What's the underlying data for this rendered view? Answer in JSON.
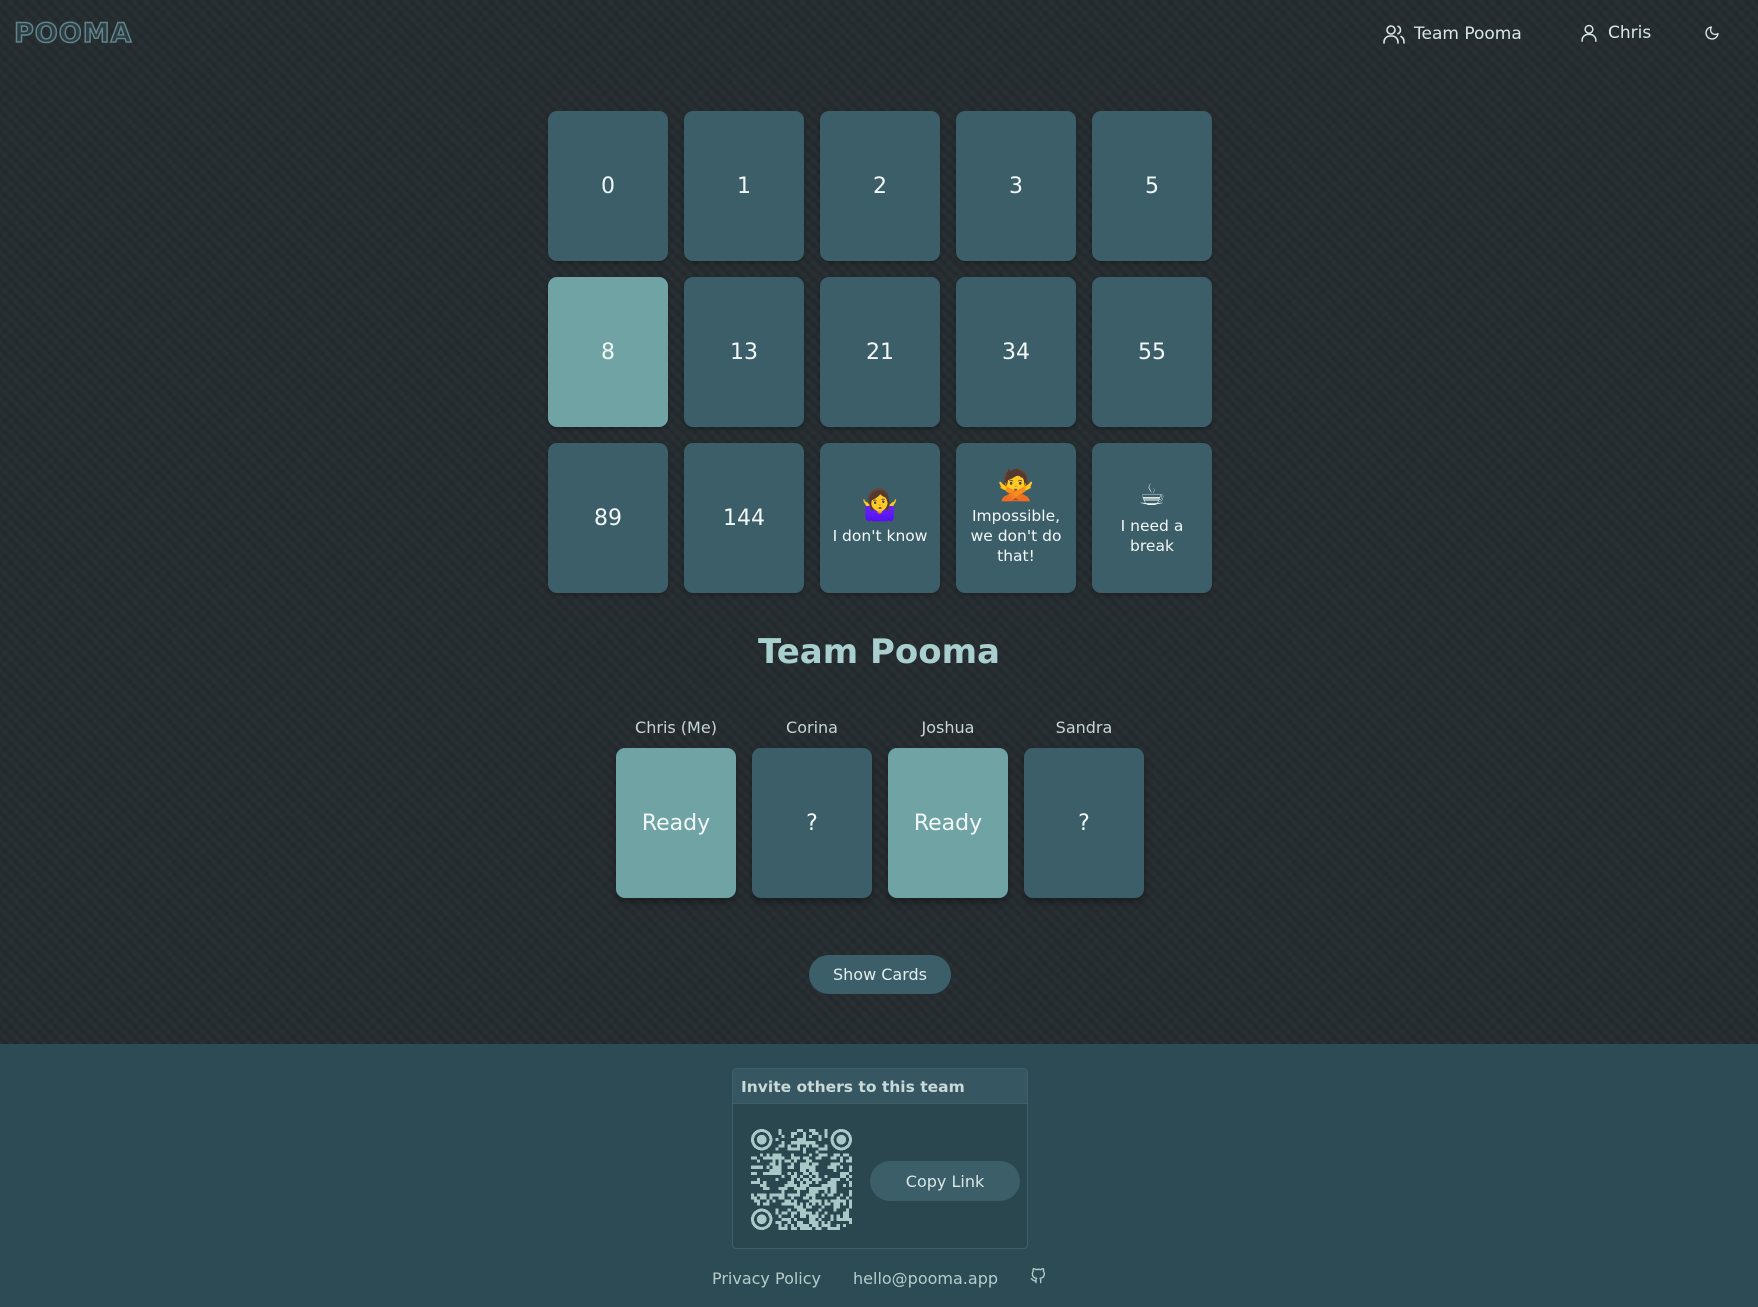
{
  "header": {
    "logo": "POOMA",
    "team_name": "Team Pooma",
    "user_name": "Chris",
    "theme_icon": "moon-icon"
  },
  "deck": {
    "cards": [
      {
        "label": "0"
      },
      {
        "label": "1"
      },
      {
        "label": "2"
      },
      {
        "label": "3"
      },
      {
        "label": "5"
      },
      {
        "label": "8",
        "selected": true
      },
      {
        "label": "13"
      },
      {
        "label": "21"
      },
      {
        "label": "34"
      },
      {
        "label": "55"
      },
      {
        "label": "89"
      },
      {
        "label": "144"
      },
      {
        "emoji": "🤷‍♀️",
        "label": "I don't know"
      },
      {
        "emoji": "🙅",
        "label": "Impossible, we don't do that!"
      },
      {
        "emoji": "☕",
        "label": "I need a break"
      }
    ]
  },
  "team": {
    "title": "Team Pooma",
    "players": [
      {
        "name": "Chris (Me)",
        "status": "Ready"
      },
      {
        "name": "Corina",
        "status": "?"
      },
      {
        "name": "Joshua",
        "status": "Ready"
      },
      {
        "name": "Sandra",
        "status": "?"
      }
    ],
    "show_cards_label": "Show Cards"
  },
  "footer": {
    "invite_title": "Invite others to this team",
    "copy_link_label": "Copy Link",
    "privacy_label": "Privacy Policy",
    "email": "hello@pooma.app",
    "github_icon": "github-icon"
  },
  "colors": {
    "card": "#3b5e68",
    "card_selected": "#70a3a4",
    "footer_bg": "#2c4b54",
    "accent_text": "#a9cfcf"
  }
}
